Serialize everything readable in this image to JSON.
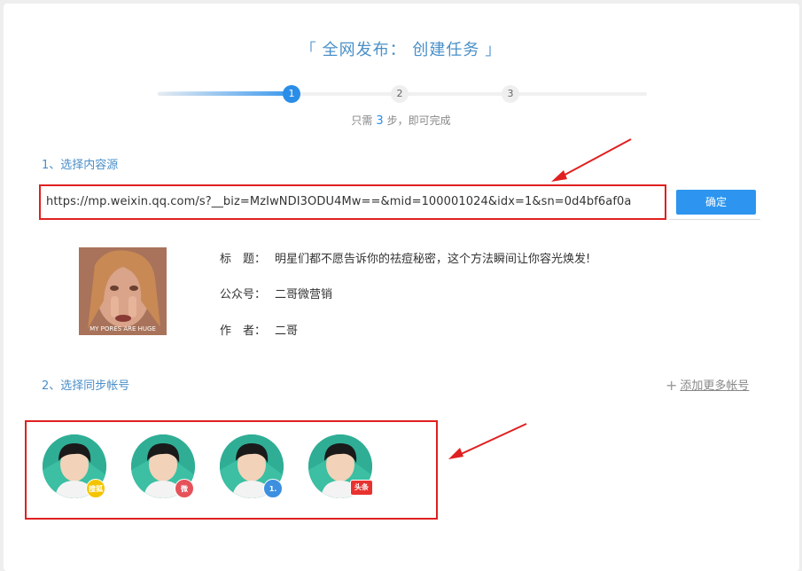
{
  "header": {
    "bracket_open": "「",
    "title": "全网发布：",
    "subtitle": "创建任务",
    "bracket_close": "」"
  },
  "steps": {
    "items": [
      "1",
      "2",
      "3"
    ],
    "active_index": 0,
    "hint_prefix": "只需",
    "hint_count": "3",
    "hint_suffix": "步，即可完成"
  },
  "source_section": {
    "label": "1、选择内容源",
    "url_value": "https://mp.weixin.qq.com/s?__biz=MzIwNDI3ODU4Mw==&mid=100001024&idx=1&sn=0d4bf6af0a",
    "confirm_label": "确定"
  },
  "article": {
    "thumbnail_caption": "MY PORES ARE HUGE",
    "title_label": "标　题：",
    "title_value": "明星们都不愿告诉你的祛痘秘密，这个方法瞬间让你容光焕发!",
    "account_label": "公众号：",
    "account_value": "二哥微营销",
    "author_label": "作　者：",
    "author_value": "二哥"
  },
  "accounts_section": {
    "label": "2、选择同步帐号",
    "add_more_label": "添加更多帐号",
    "accounts": [
      {
        "badge_icon": "sohu-badge-icon",
        "badge_color": "#f5c400",
        "badge_text": "搜狐"
      },
      {
        "badge_icon": "weibo-badge-icon",
        "badge_color": "#e6525a",
        "badge_text": "微"
      },
      {
        "badge_icon": "yidian-badge-icon",
        "badge_color": "#3d8fe0",
        "badge_text": "1."
      },
      {
        "badge_icon": "toutiao-badge-icon",
        "badge_color": "#e8322f",
        "badge_text": "头条"
      }
    ]
  },
  "colors": {
    "accent": "#2d95ef",
    "highlight_border": "#e02020",
    "label_blue": "#4a8ec8"
  }
}
